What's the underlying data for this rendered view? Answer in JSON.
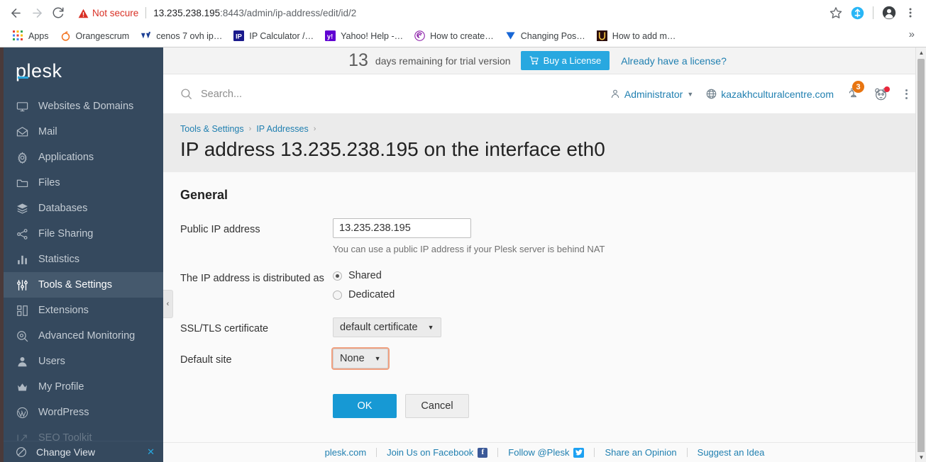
{
  "browser": {
    "back_icon": "back-arrow-icon",
    "forward_icon": "forward-arrow-icon",
    "reload_icon": "reload-icon",
    "security_label": "Not secure",
    "url_host": "13.235.238.195",
    "url_path": ":8443/admin/ip-address/edit/id/2",
    "star_icon": "bookmark-star-icon",
    "extension_icon": "extension-icon",
    "profile_icon": "profile-avatar-icon",
    "menu_icon": "chrome-menu-icon",
    "bookmarks": [
      {
        "label": "Apps",
        "icon": "apps-grid-icon"
      },
      {
        "label": "Orangescrum",
        "icon": "orangescrum-favicon"
      },
      {
        "label": "cenos 7 ovh ip…",
        "icon": "cenos-favicon"
      },
      {
        "label": "IP Calculator /…",
        "icon": "ip-calculator-favicon"
      },
      {
        "label": "Yahoo! Help -…",
        "icon": "yahoo-favicon"
      },
      {
        "label": "How to create…",
        "icon": "howto-create-favicon"
      },
      {
        "label": "Changing Pos…",
        "icon": "changing-pos-favicon"
      },
      {
        "label": "How to add m…",
        "icon": "howto-add-favicon"
      }
    ],
    "overflow_label": "»"
  },
  "sidebar": {
    "logo": "plesk",
    "items": [
      {
        "label": "Websites & Domains",
        "icon": "monitor-icon",
        "active": false
      },
      {
        "label": "Mail",
        "icon": "envelope-icon",
        "active": false
      },
      {
        "label": "Applications",
        "icon": "gear-icon",
        "active": false
      },
      {
        "label": "Files",
        "icon": "folder-icon",
        "active": false
      },
      {
        "label": "Databases",
        "icon": "database-stack-icon",
        "active": false
      },
      {
        "label": "File Sharing",
        "icon": "share-nodes-icon",
        "active": false
      },
      {
        "label": "Statistics",
        "icon": "bar-chart-icon",
        "active": false
      },
      {
        "label": "Tools & Settings",
        "icon": "sliders-icon",
        "active": true
      },
      {
        "label": "Extensions",
        "icon": "blocks-icon",
        "active": false
      },
      {
        "label": "Advanced Monitoring",
        "icon": "magnifier-at-icon",
        "active": false
      },
      {
        "label": "Users",
        "icon": "user-icon",
        "active": false
      },
      {
        "label": "My Profile",
        "icon": "crown-icon",
        "active": false
      },
      {
        "label": "WordPress",
        "icon": "wordpress-icon",
        "active": false
      },
      {
        "label": "SEO Toolkit",
        "icon": "seo-chart-icon",
        "active": false
      }
    ],
    "change_view": {
      "label": "Change View",
      "icon": "circle-slash-icon",
      "close": "✕"
    },
    "collapse_icon": "‹"
  },
  "trial": {
    "days": "13",
    "text": "days remaining for trial version",
    "buy_label": "Buy a License",
    "buy_icon": "shopping-cart-icon",
    "already_label": "Already have a license?"
  },
  "topbar": {
    "search_placeholder": "Search...",
    "search_value": "",
    "search_icon": "search-icon",
    "admin_label": "Administrator",
    "admin_icon": "person-icon",
    "admin_caret": "⌄",
    "domain_label": "kazakhculturalcentre.com",
    "domain_icon": "globe-icon",
    "bell_icon": "bell-icon",
    "bell_badge": "3",
    "assistant_icon": "panda-face-icon",
    "kebab_icon": "kebab-menu-icon"
  },
  "page": {
    "breadcrumb": [
      {
        "label": "Tools & Settings"
      },
      {
        "label": "IP Addresses"
      }
    ],
    "breadcrumb_sep": "›",
    "title": "IP address 13.235.238.195 on the interface eth0",
    "section_title": "General"
  },
  "form": {
    "public_ip": {
      "label": "Public IP address",
      "value": "13.235.238.195",
      "placeholder": "",
      "hint": "You can use a public IP address if your Plesk server is behind NAT"
    },
    "distribution": {
      "label": "The IP address is distributed as",
      "options": [
        {
          "label": "Shared",
          "checked": true
        },
        {
          "label": "Dedicated",
          "checked": false
        }
      ]
    },
    "ssl_certificate": {
      "label": "SSL/TLS certificate",
      "value": "default certificate",
      "arrow": "▼"
    },
    "default_site": {
      "label": "Default site",
      "value": "None",
      "arrow": "▼"
    },
    "ok_label": "OK",
    "cancel_label": "Cancel"
  },
  "footer": {
    "links": [
      {
        "label": "plesk.com",
        "icon": ""
      },
      {
        "label": "Join Us on Facebook",
        "icon": "facebook-icon"
      },
      {
        "label": "Follow @Plesk",
        "icon": "twitter-icon"
      },
      {
        "label": "Share an Opinion",
        "icon": ""
      },
      {
        "label": "Suggest an Idea",
        "icon": ""
      }
    ]
  },
  "colors": {
    "accent_blue": "#28a8e0",
    "sidebar_bg": "#35495e",
    "link_blue": "#1f7fb0",
    "badge_orange": "#e87511",
    "warning_red": "#d93025",
    "focus_orange": "#f0a080"
  }
}
